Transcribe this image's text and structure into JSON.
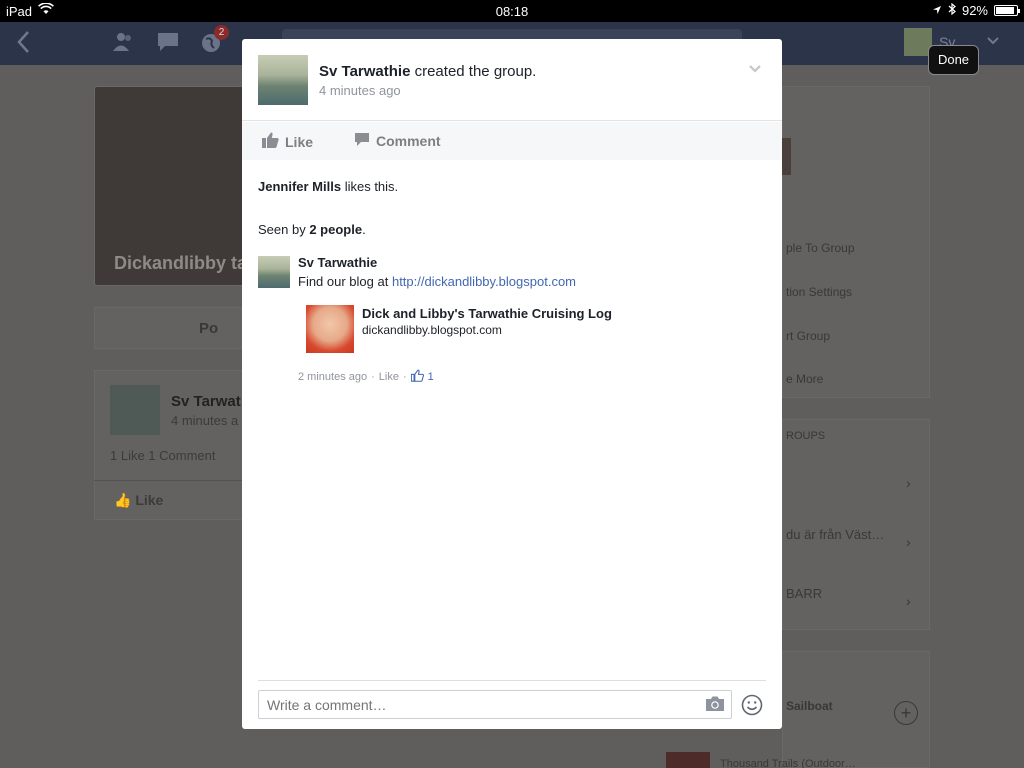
{
  "status_bar": {
    "device": "iPad",
    "time": "08:18",
    "battery": "92%"
  },
  "nav": {
    "notification_count": "2",
    "me_name": "Sv"
  },
  "done_label": "Done",
  "background": {
    "group_title": "Dickandlibby ta",
    "post_label": "Po",
    "feed_name": "Sv Tarwat",
    "feed_time": "4 minutes a",
    "feed_counts": "1 Like   1 Comment",
    "feed_like": "Like",
    "side_items": [
      "ple To Group",
      "tion Settings",
      "rt Group",
      "e More"
    ],
    "groups_header": "ROUPS",
    "group_rows": [
      "du är från Väst…",
      "BARR"
    ],
    "suggest_rows": [
      "Sailboat",
      "Thousand Trails (Outdoor…"
    ]
  },
  "modal": {
    "author": "Sv Tarwathie",
    "action": "created the group.",
    "time": "4 minutes ago",
    "like_label": "Like",
    "comment_label": "Comment",
    "likes_name": "Jennifer Mills",
    "likes_suffix": "likes this.",
    "seen_prefix": "Seen by",
    "seen_count": "2 people",
    "seen_suffix": ".",
    "comment": {
      "author": "Sv Tarwathie",
      "text_prefix": "Find our blog at",
      "link": "http://dickandlibby.blogspot.com",
      "attachment_title": "Dick and Libby's Tarwathie Cruising Log",
      "attachment_url": "dickandlibby.blogspot.com",
      "time": "2 minutes ago",
      "like_label": "Like",
      "like_count": "1"
    },
    "comment_placeholder": "Write a comment…"
  }
}
